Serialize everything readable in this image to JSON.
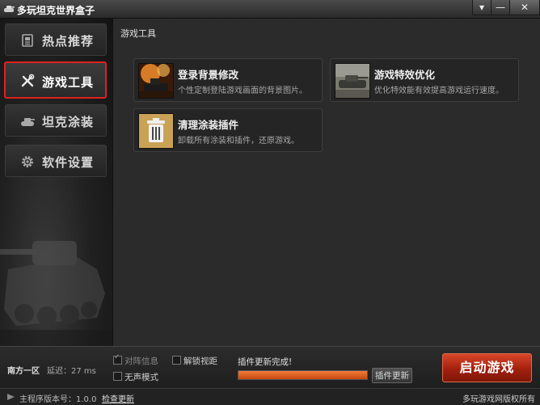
{
  "app": {
    "title": "多玩坦克世界盒子"
  },
  "window_controls": {
    "menu": "▾",
    "minimize": "—",
    "close": "✕"
  },
  "sidebar": {
    "items": [
      {
        "label": "热点推荐",
        "icon": "document-icon",
        "active": false
      },
      {
        "label": "游戏工具",
        "icon": "tools-icon",
        "active": true
      },
      {
        "label": "坦克涂装",
        "icon": "tank-icon",
        "active": false
      },
      {
        "label": "软件设置",
        "icon": "gear-icon",
        "active": false
      }
    ]
  },
  "main": {
    "breadcrumb": "游戏工具",
    "cards": [
      {
        "title": "登录背景修改",
        "desc": "个性定制登陆游戏画面的背景图片。",
        "icon": "battle-scene-thumbnail"
      },
      {
        "title": "游戏特效优化",
        "desc": "优化特效能有效提高游戏运行速度。",
        "icon": "tank-photo-thumbnail"
      },
      {
        "title": "清理涂装插件",
        "desc": "卸载所有涂装和插件，还原游戏。",
        "icon": "trash-icon"
      }
    ]
  },
  "bottom": {
    "server_name": "南方一区",
    "latency": "延迟：27 ms",
    "options": {
      "enemy_info": {
        "label": "对阵信息",
        "checked": true
      },
      "unlock_view": {
        "label": "解锁视距",
        "checked": false
      },
      "silent_mode": {
        "label": "无声模式",
        "checked": false
      }
    },
    "update_status": "插件更新完成!",
    "update_progress": 1.0,
    "plugin_update_label": "插件更新",
    "launch_label": "启动游戏"
  },
  "status": {
    "version": "主程序版本号：1.0.0",
    "check_update": "检查更新",
    "copyright": "多玩游戏网版权所有"
  },
  "colors": {
    "accent_red": "#e02020",
    "launch": "#b52a12",
    "progress": "#e86a2c"
  }
}
